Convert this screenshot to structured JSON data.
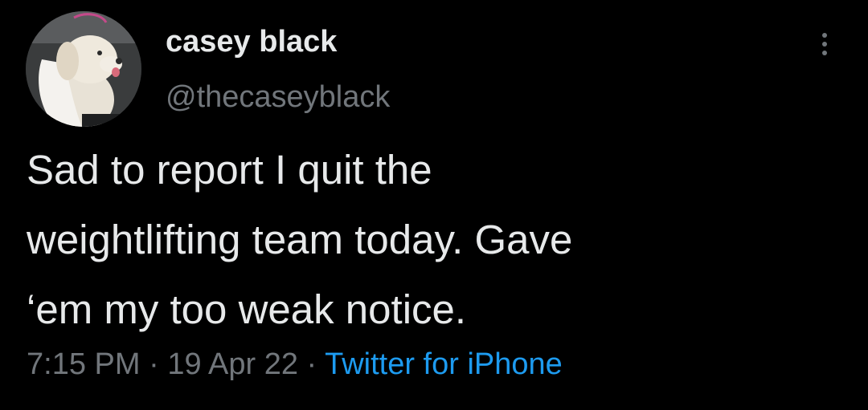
{
  "author": {
    "display_name": "casey black",
    "handle": "@thecaseyblack",
    "avatar_icon": "dog-avatar-photo"
  },
  "more_menu": {
    "icon": "vertical-ellipsis-icon"
  },
  "tweet": {
    "lines": [
      "Sad to report I quit the",
      "weightlifting team today. Gave",
      "‘em my too weak notice."
    ]
  },
  "meta": {
    "time": "7:15 PM",
    "separator": " · ",
    "date": "19 Apr 22",
    "source": "Twitter for iPhone"
  },
  "colors": {
    "background": "#000000",
    "text": "#e7e9ea",
    "secondary": "#71767b",
    "link": "#1d9bf0"
  }
}
